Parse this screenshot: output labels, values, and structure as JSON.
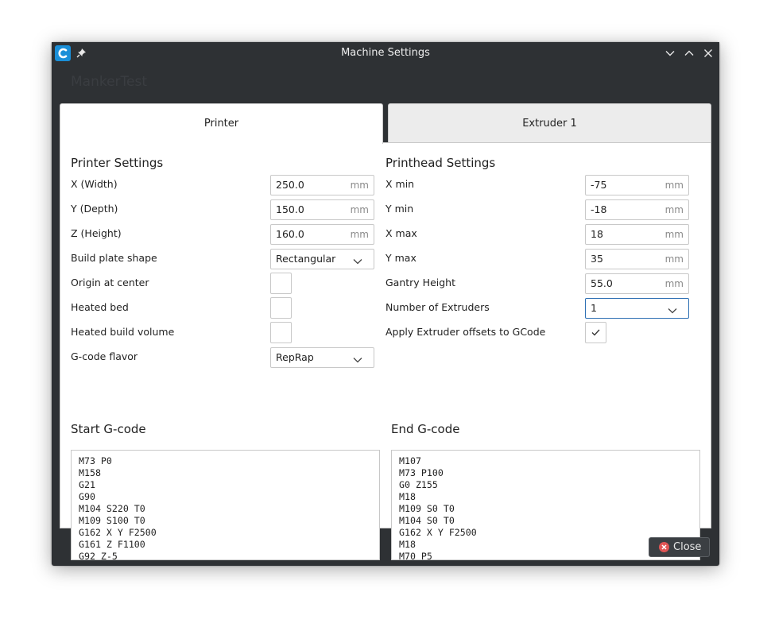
{
  "window": {
    "title": "Machine Settings",
    "printer_name": "MankerTest"
  },
  "tabs": [
    {
      "label": "Printer",
      "active": true
    },
    {
      "label": "Extruder 1",
      "active": false
    }
  ],
  "printer_settings": {
    "title": "Printer Settings",
    "x_width": {
      "label": "X (Width)",
      "value": "250.0",
      "unit": "mm"
    },
    "y_depth": {
      "label": "Y (Depth)",
      "value": "150.0",
      "unit": "mm"
    },
    "z_height": {
      "label": "Z (Height)",
      "value": "160.0",
      "unit": "mm"
    },
    "build_plate_shape": {
      "label": "Build plate shape",
      "value": "Rectangular"
    },
    "origin_at_center": {
      "label": "Origin at center",
      "checked": false
    },
    "heated_bed": {
      "label": "Heated bed",
      "checked": false
    },
    "heated_build_volume": {
      "label": "Heated build volume",
      "checked": false
    },
    "gcode_flavor": {
      "label": "G-code flavor",
      "value": "RepRap"
    }
  },
  "printhead_settings": {
    "title": "Printhead Settings",
    "x_min": {
      "label": "X min",
      "value": "-75",
      "unit": "mm"
    },
    "y_min": {
      "label": "Y min",
      "value": "-18",
      "unit": "mm"
    },
    "x_max": {
      "label": "X max",
      "value": "18",
      "unit": "mm"
    },
    "y_max": {
      "label": "Y max",
      "value": "35",
      "unit": "mm"
    },
    "gantry_height": {
      "label": "Gantry Height",
      "value": "55.0",
      "unit": "mm"
    },
    "number_of_extruders": {
      "label": "Number of Extruders",
      "value": "1"
    },
    "apply_extruder_offsets": {
      "label": "Apply Extruder offsets to GCode",
      "checked": true
    }
  },
  "start_gcode": {
    "title": "Start G-code",
    "text": "M73 P0\nM158\nG21\nG90\nM104 S220 T0\nM109 S100 T0\nG162 X Y F2500\nG161 Z F1100\nG92 Z-5"
  },
  "end_gcode": {
    "title": "End G-code",
    "text": "M107\nM73 P100\nG0 Z155\nM18\nM109 S0 T0\nM104 S0 T0\nG162 X Y F2500\nM18\nM70 P5"
  },
  "footer": {
    "close_label": "Close"
  },
  "colors": {
    "window_bg": "#2e3134",
    "accent": "#1a8fd8",
    "close_icon": "#e05555",
    "focus": "#2d6fb3"
  }
}
